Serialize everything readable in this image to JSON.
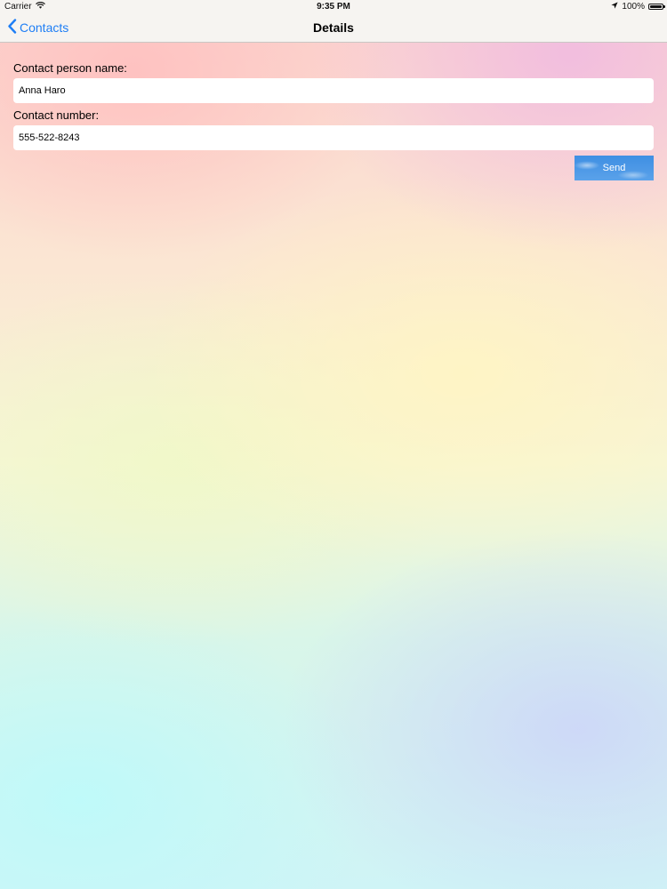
{
  "status_bar": {
    "carrier": "Carrier",
    "time": "9:35 PM",
    "battery_percent": "100%",
    "battery_level": 1.0
  },
  "nav": {
    "back_label": "Contacts",
    "title": "Details"
  },
  "form": {
    "name_label": "Contact person name:",
    "name_value": "Anna Haro",
    "number_label": "Contact number:",
    "number_value": "555-522-8243",
    "send_label": "Send"
  },
  "icons": {
    "wifi": "wifi-icon",
    "location": "location-arrow-icon",
    "battery": "battery-icon",
    "back": "chevron-left-icon"
  },
  "colors": {
    "accent": "#1e7ef5",
    "send_button": "#4c98e6",
    "bar_background": "#f6f4f1"
  }
}
